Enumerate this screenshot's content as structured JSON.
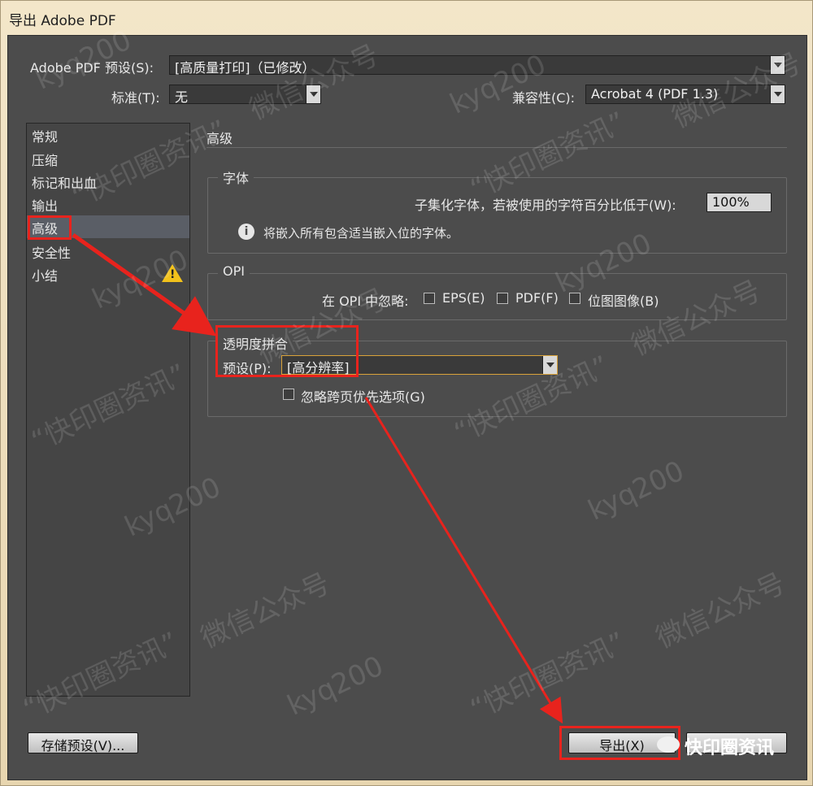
{
  "window": {
    "title": "导出 Adobe PDF"
  },
  "header": {
    "preset_label": "Adobe PDF 预设(S):",
    "preset_value": "[高质量打印]（已修改）",
    "standard_label": "标准(T):",
    "standard_value": "无",
    "compat_label": "兼容性(C):",
    "compat_value": "Acrobat 4 (PDF 1.3)"
  },
  "sidebar": {
    "items": [
      {
        "label": "常规"
      },
      {
        "label": "压缩"
      },
      {
        "label": "标记和出血"
      },
      {
        "label": "输出"
      },
      {
        "label": "高级"
      },
      {
        "label": "安全性"
      },
      {
        "label": "小结"
      }
    ],
    "selected": "高级"
  },
  "panel": {
    "heading": "高级",
    "fonts": {
      "title": "字体",
      "subset_label": "子集化字体，若被使用的字符百分比低于(W):",
      "subset_value": "100%",
      "info_text": "将嵌入所有包含适当嵌入位的字体。"
    },
    "opi": {
      "title": "OPI",
      "omit_label": "在 OPI 中忽略:",
      "eps": "EPS(E)",
      "pdf": "PDF(F)",
      "bitmap": "位图图像(B)"
    },
    "flatten": {
      "title": "透明度拼合",
      "preset_label": "预设(P):",
      "preset_value": "[高分辨率]",
      "ignore_label": "忽略跨页优先选项(G)"
    }
  },
  "footer": {
    "save_preset": "存储预设(V)...",
    "export": "导出(X)",
    "brand": "快印圈资讯"
  },
  "watermarks": [
    "kyq200",
    "“快印圈资讯”",
    "微信公众号"
  ],
  "colors": {
    "dialog_bg": "#4c4c4c",
    "highlight": "#e8231d",
    "selection": "#5a5e66"
  }
}
